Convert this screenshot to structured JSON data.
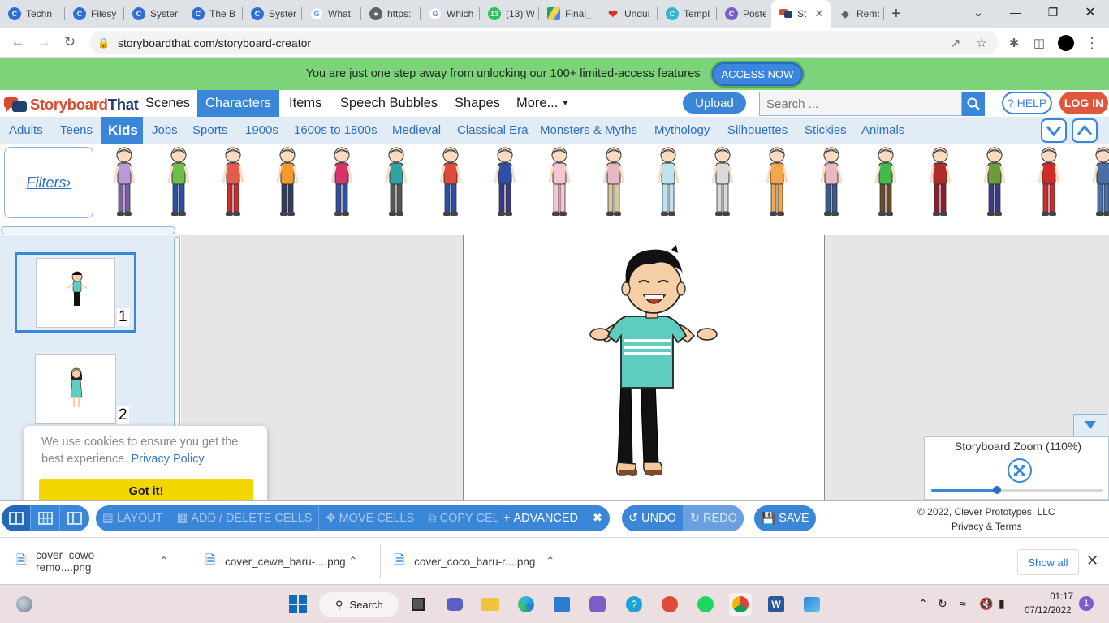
{
  "browser": {
    "tabs": [
      {
        "label": "Techn",
        "favicon": "c-blue"
      },
      {
        "label": "Filesy",
        "favicon": "c-blue"
      },
      {
        "label": "Syster",
        "favicon": "c-blue"
      },
      {
        "label": "The B",
        "favicon": "c-blue"
      },
      {
        "label": "Syster",
        "favicon": "c-blue"
      },
      {
        "label": "What",
        "favicon": "google"
      },
      {
        "label": "https:",
        "favicon": "globe"
      },
      {
        "label": "Which",
        "favicon": "google"
      },
      {
        "label": "(13) W",
        "favicon": "whatsapp"
      },
      {
        "label": "Final_",
        "favicon": "drive"
      },
      {
        "label": "Undui",
        "favicon": "heart"
      },
      {
        "label": "Templ",
        "favicon": "canva"
      },
      {
        "label": "Poster",
        "favicon": "canva"
      },
      {
        "label": "St",
        "favicon": "storyboard",
        "active": true
      },
      {
        "label": "Remo",
        "favicon": "layers"
      }
    ],
    "url": "storyboardthat.com/storyboard-creator"
  },
  "promo": {
    "text": "You are just one step away from unlocking our 100+ limited-access features",
    "button": "ACCESS NOW"
  },
  "app": {
    "logo_part1": "Storyboard",
    "logo_part2": "That",
    "nav": [
      "Scenes",
      "Characters",
      "Items",
      "Speech Bubbles",
      "Shapes",
      "More..."
    ],
    "nav_selected": "Characters",
    "upload": "Upload",
    "search_placeholder": "Search ...",
    "help": "HELP",
    "login": "LOG IN"
  },
  "categories": {
    "items": [
      "Adults",
      "Teens",
      "Kids",
      "Jobs",
      "Sports",
      "1900s",
      "1600s to 1800s",
      "Medieval",
      "Classical Era",
      "Monsters & Myths",
      "Mythology",
      "Silhouettes",
      "Stickies",
      "Animals"
    ],
    "selected": "Kids"
  },
  "filters": "Filters›",
  "cells": [
    {
      "number": "1"
    },
    {
      "number": "2"
    }
  ],
  "zoom": {
    "title": "Storyboard Zoom (110%)",
    "level_fraction": 0.38
  },
  "cookie": {
    "text": "We use cookies to ensure you get the best experience.",
    "link": "Privacy Policy",
    "button": "Got it!"
  },
  "toolbar": {
    "layout": "LAYOUT",
    "add_delete": "ADD / DELETE CELLS",
    "move": "MOVE CELLS",
    "copy": "COPY CELLS",
    "advanced": "ADVANCED",
    "undo": "UNDO",
    "redo": "REDO",
    "save": "SAVE"
  },
  "footer": {
    "copyright": "© 2022, Clever Prototypes, LLC",
    "privacy": "Privacy & Terms"
  },
  "downloads": {
    "items": [
      "cover_cowo-remo....png",
      "cover_cewe_baru-....png",
      "cover_coco_baru-r....png"
    ],
    "show_all": "Show all"
  },
  "taskbar": {
    "search": "Search",
    "time": "01:17",
    "date": "07/12/2022",
    "notifications": "1"
  },
  "colors": {
    "accent": "#3a86d9",
    "promo_bg": "#7cd37a",
    "login": "#e0573e",
    "cookie_button": "#f1d600"
  }
}
